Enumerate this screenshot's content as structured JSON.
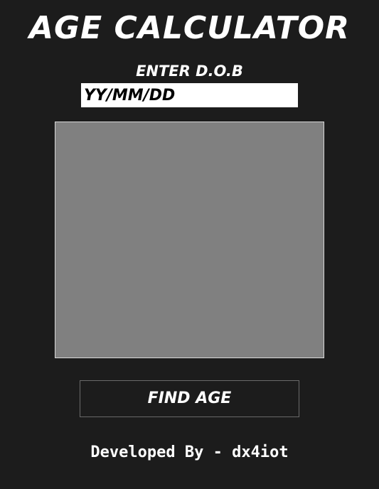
{
  "app": {
    "title": "AGE CALCULATOR"
  },
  "dob": {
    "label": "ENTER D.O.B",
    "placeholder": "YY/MM/DD",
    "value": ""
  },
  "result": {
    "text": ""
  },
  "actions": {
    "find_age_label": "FIND AGE"
  },
  "footer": {
    "credit": "Developed By - dx4iot"
  },
  "colors": {
    "background": "#1c1c1c",
    "result_area": "#808080",
    "input_background": "#ffffff",
    "text": "#ffffff"
  }
}
